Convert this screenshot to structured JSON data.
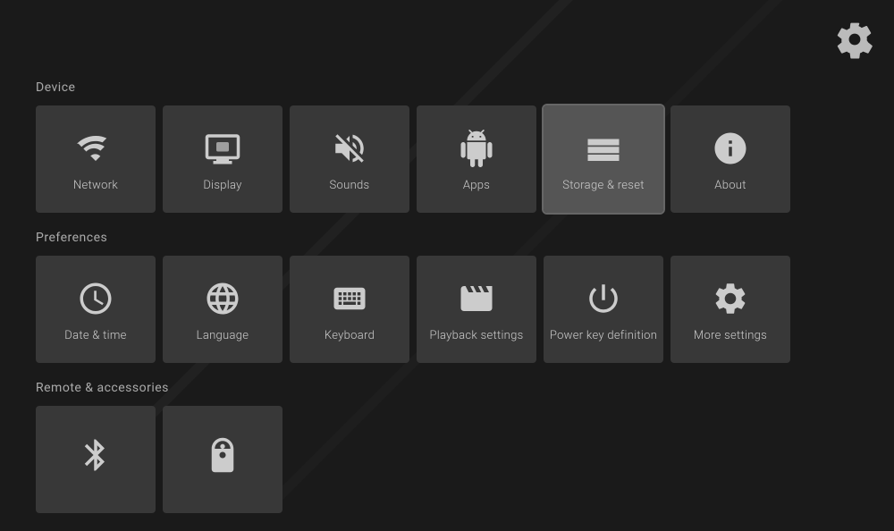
{
  "settings_icon": "gear-icon",
  "sections": [
    {
      "name": "Device",
      "key": "device",
      "tiles": [
        {
          "key": "network",
          "label": "Network",
          "icon": "wifi"
        },
        {
          "key": "display",
          "label": "Display",
          "icon": "display"
        },
        {
          "key": "sounds",
          "label": "Sounds",
          "icon": "mute"
        },
        {
          "key": "apps",
          "label": "Apps",
          "icon": "android"
        },
        {
          "key": "storage-reset",
          "label": "Storage & reset",
          "icon": "storage",
          "active": true
        },
        {
          "key": "about",
          "label": "About",
          "icon": "info"
        }
      ]
    },
    {
      "name": "Preferences",
      "key": "preferences",
      "tiles": [
        {
          "key": "date-time",
          "label": "Date & time",
          "icon": "clock"
        },
        {
          "key": "language",
          "label": "Language",
          "icon": "globe"
        },
        {
          "key": "keyboard",
          "label": "Keyboard",
          "icon": "keyboard"
        },
        {
          "key": "playback-settings",
          "label": "Playback settings",
          "icon": "film"
        },
        {
          "key": "power-key-definition",
          "label": "Power key definition",
          "icon": "power"
        },
        {
          "key": "more-settings",
          "label": "More settings",
          "icon": "gear-settings"
        }
      ]
    },
    {
      "name": "Remote & accessories",
      "key": "remote",
      "tiles": [
        {
          "key": "bluetooth",
          "label": "",
          "icon": "bluetooth"
        },
        {
          "key": "remote",
          "label": "",
          "icon": "remote"
        }
      ]
    }
  ]
}
